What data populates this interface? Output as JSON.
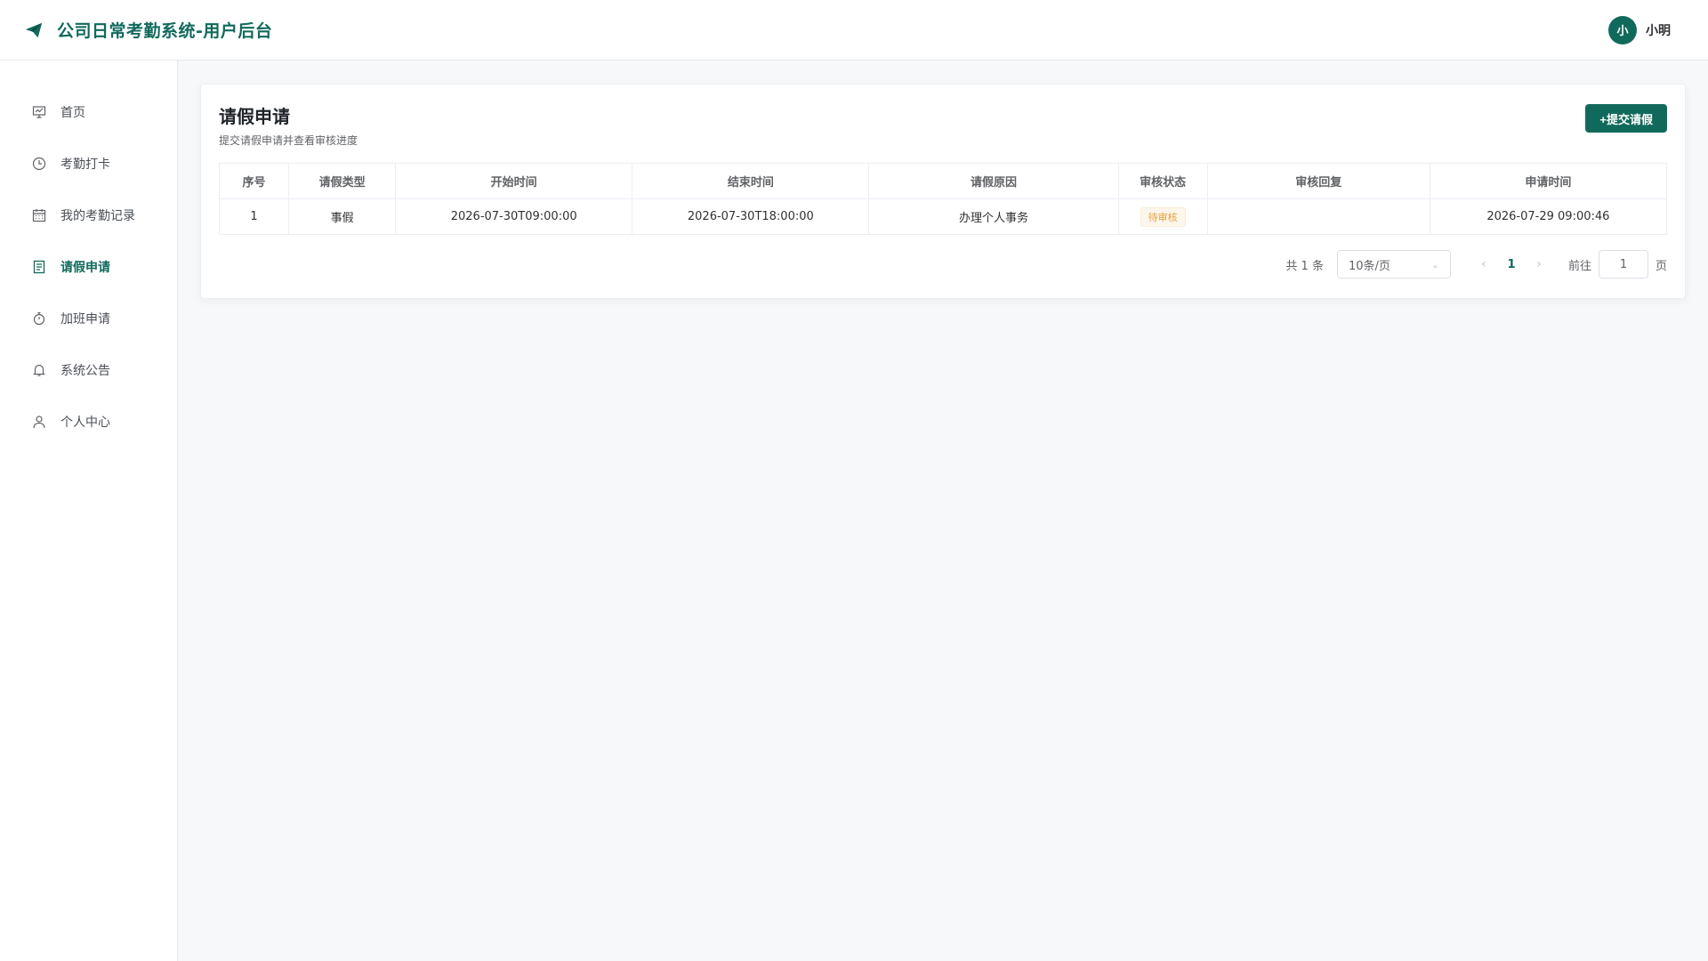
{
  "colors": {
    "primary": "#11695c",
    "warning": "#e6a23c",
    "border": "#ebeef5"
  },
  "header": {
    "logo_icon": "paper-plane-icon",
    "title": "公司日常考勤系统-用户后台",
    "avatar_text": "小",
    "username": "小明"
  },
  "sidebar": {
    "items": [
      {
        "icon": "presentation-icon",
        "label": "首页",
        "active": false
      },
      {
        "icon": "clock-icon",
        "label": "考勤打卡",
        "active": false
      },
      {
        "icon": "calendar-icon",
        "label": "我的考勤记录",
        "active": false
      },
      {
        "icon": "document-icon",
        "label": "请假申请",
        "active": true
      },
      {
        "icon": "stopwatch-icon",
        "label": "加班申请",
        "active": false
      },
      {
        "icon": "bell-icon",
        "label": "系统公告",
        "active": false
      },
      {
        "icon": "user-icon",
        "label": "个人中心",
        "active": false
      }
    ]
  },
  "main": {
    "title": "请假申请",
    "subtitle": "提交请假申请并查看审核进度",
    "submit_button": "+提交请假",
    "table": {
      "headers": [
        "序号",
        "请假类型",
        "开始时间",
        "结束时间",
        "请假原因",
        "审核状态",
        "审核回复",
        "申请时间"
      ],
      "rows": [
        [
          "1",
          "事假",
          "2026-07-30T09:00:00",
          "2026-07-30T18:00:00",
          "办理个人事务",
          "待审核",
          "",
          "2026-07-29 09:00:46"
        ]
      ]
    },
    "pagination": {
      "total": "共 1 条",
      "page_size": "10条/页",
      "current_page": "1",
      "goto_label": "前往",
      "goto_value": "1",
      "goto_suffix": "页"
    }
  }
}
